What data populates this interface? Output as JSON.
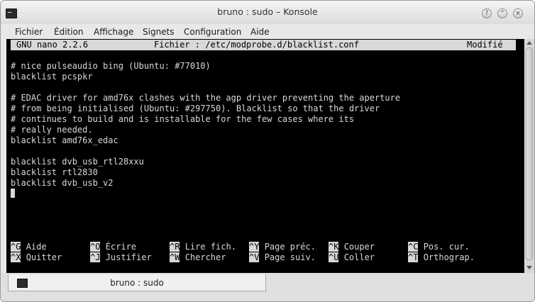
{
  "window": {
    "title": "bruno : sudo – Konsole"
  },
  "titlebar": {
    "help_glyph": "?",
    "min_glyph": "^",
    "close_glyph": "×"
  },
  "menu": [
    "Fichier",
    "Édition",
    "Affichage",
    "Signets",
    "Configuration",
    "Aide"
  ],
  "nano": {
    "version": "GNU nano 2.2.6",
    "file": "Fichier : /etc/modprobe.d/blacklist.conf",
    "status": "Modifié"
  },
  "terminal_lines": "# nice pulseaudio bing (Ubuntu: #77010)\nblacklist pcspkr\n\n# EDAC driver for amd76x clashes with the agp driver preventing the aperture\n# from being initialised (Ubuntu: #297750). Blacklist so that the driver\n# continues to build and is installable for the few cases where its\n# really needed.\nblacklist amd76x_edac\n\nblacklist dvb_usb_rtl28xxu\nblacklist rtl2830\nblacklist dvb_usb_v2",
  "shortcuts": [
    {
      "key": "^G",
      "label": "Aide"
    },
    {
      "key": "^O",
      "label": "Écrire"
    },
    {
      "key": "^R",
      "label": "Lire fich."
    },
    {
      "key": "^Y",
      "label": "Page préc."
    },
    {
      "key": "^K",
      "label": "Couper"
    },
    {
      "key": "^C",
      "label": "Pos. cur."
    },
    {
      "key": "^X",
      "label": "Quitter"
    },
    {
      "key": "^J",
      "label": "Justifier"
    },
    {
      "key": "^W",
      "label": "Chercher"
    },
    {
      "key": "^V",
      "label": "Page suiv."
    },
    {
      "key": "^U",
      "label": "Coller"
    },
    {
      "key": "^T",
      "label": "Orthograp."
    }
  ],
  "tab": {
    "label": "bruno : sudo"
  }
}
